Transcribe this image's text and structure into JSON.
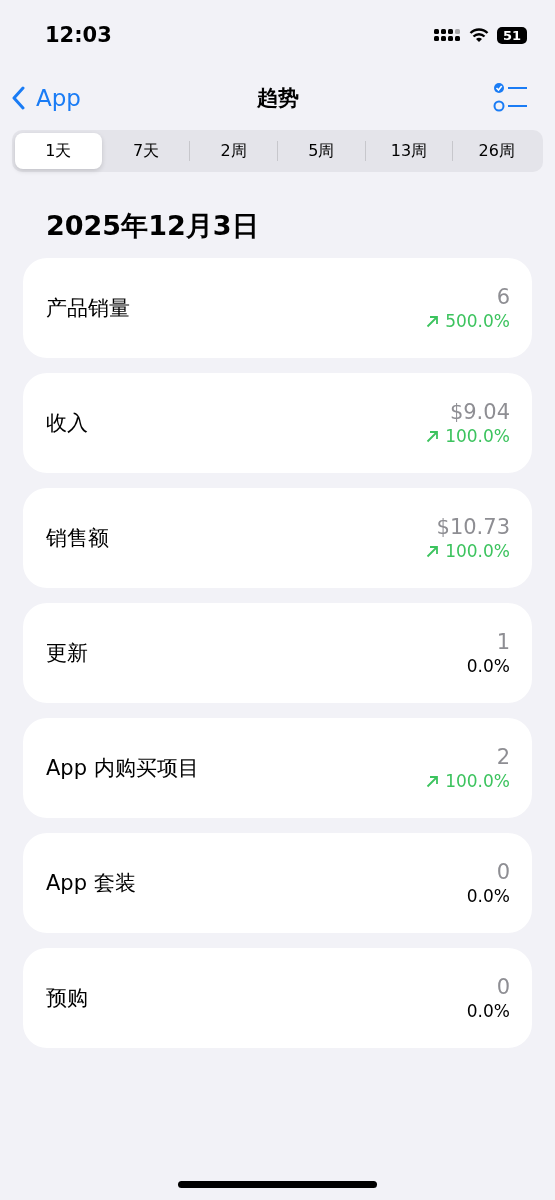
{
  "status_bar": {
    "time": "12:03",
    "battery": "51"
  },
  "nav": {
    "back": "App",
    "title": "趋势"
  },
  "periods": [
    {
      "label": "1天",
      "selected": true
    },
    {
      "label": "7天",
      "selected": false
    },
    {
      "label": "2周",
      "selected": false
    },
    {
      "label": "5周",
      "selected": false
    },
    {
      "label": "13周",
      "selected": false
    },
    {
      "label": "26周",
      "selected": false
    }
  ],
  "date": "2025年12月3日",
  "metrics": [
    {
      "label": "产品销量",
      "value": "6",
      "change": "500.0%",
      "rising": true
    },
    {
      "label": "收入",
      "value": "$9.04",
      "change": "100.0%",
      "rising": true
    },
    {
      "label": "销售额",
      "value": "$10.73",
      "change": "100.0%",
      "rising": true
    },
    {
      "label": "更新",
      "value": "1",
      "change": "0.0%",
      "rising": false
    },
    {
      "label": "App 内购买项目",
      "value": "2",
      "change": "100.0%",
      "rising": true
    },
    {
      "label": "App 套装",
      "value": "0",
      "change": "0.0%",
      "rising": false
    },
    {
      "label": "预购",
      "value": "0",
      "change": "0.0%",
      "rising": false
    }
  ]
}
